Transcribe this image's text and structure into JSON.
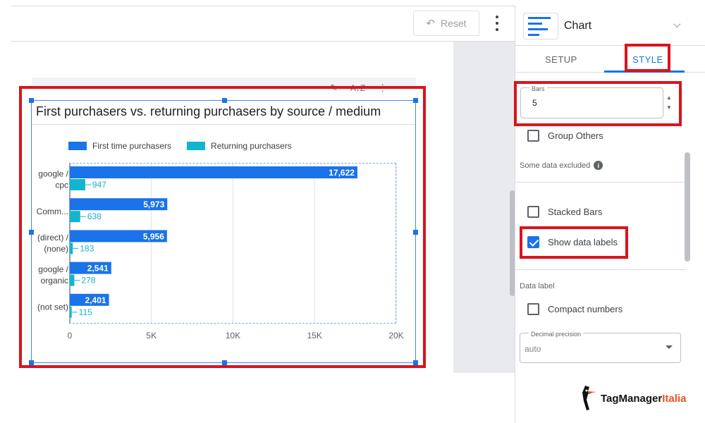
{
  "toolbar": {
    "reset_label": "Reset"
  },
  "chart": {
    "title": "First purchasers vs. returning purchasers by source / medium",
    "colors": {
      "first": "#1a73e8",
      "returning": "#12b5cb"
    }
  },
  "chart_data": {
    "type": "bar",
    "orientation": "horizontal",
    "categories": [
      [
        "google /",
        "cpc"
      ],
      [
        "Comm..."
      ],
      [
        "(direct) /",
        "(none)"
      ],
      [
        "google /",
        "organic"
      ],
      [
        "(not set)"
      ]
    ],
    "series": [
      {
        "name": "First time purchasers",
        "values": [
          17622,
          5973,
          5956,
          2541,
          2401
        ],
        "labels": [
          "17,622",
          "5,973",
          "5,956",
          "2,541",
          "2,401"
        ]
      },
      {
        "name": "Returning purchasers",
        "values": [
          947,
          638,
          183,
          278,
          115
        ],
        "labels": [
          "947",
          "638",
          "183",
          "278",
          "115"
        ]
      }
    ],
    "xticks": [
      "0",
      "5K",
      "10K",
      "15K",
      "20K"
    ],
    "xlim": [
      0,
      20000
    ],
    "grid": true,
    "legend": "top-left"
  },
  "panel": {
    "title": "Chart",
    "tabs": {
      "setup": "SETUP",
      "style": "STYLE"
    },
    "bars": {
      "label": "Bars",
      "value": "5"
    },
    "group_others": "Group Others",
    "some_data_excluded": "Some data excluded",
    "stacked_bars": "Stacked Bars",
    "show_data_labels": "Show data labels",
    "data_label_section": "Data label",
    "compact_numbers": "Compact numbers",
    "decimal_precision": {
      "label": "Decimal precision",
      "value": "auto"
    }
  },
  "logo": {
    "main": "TagManager",
    "accent": "Italia"
  }
}
